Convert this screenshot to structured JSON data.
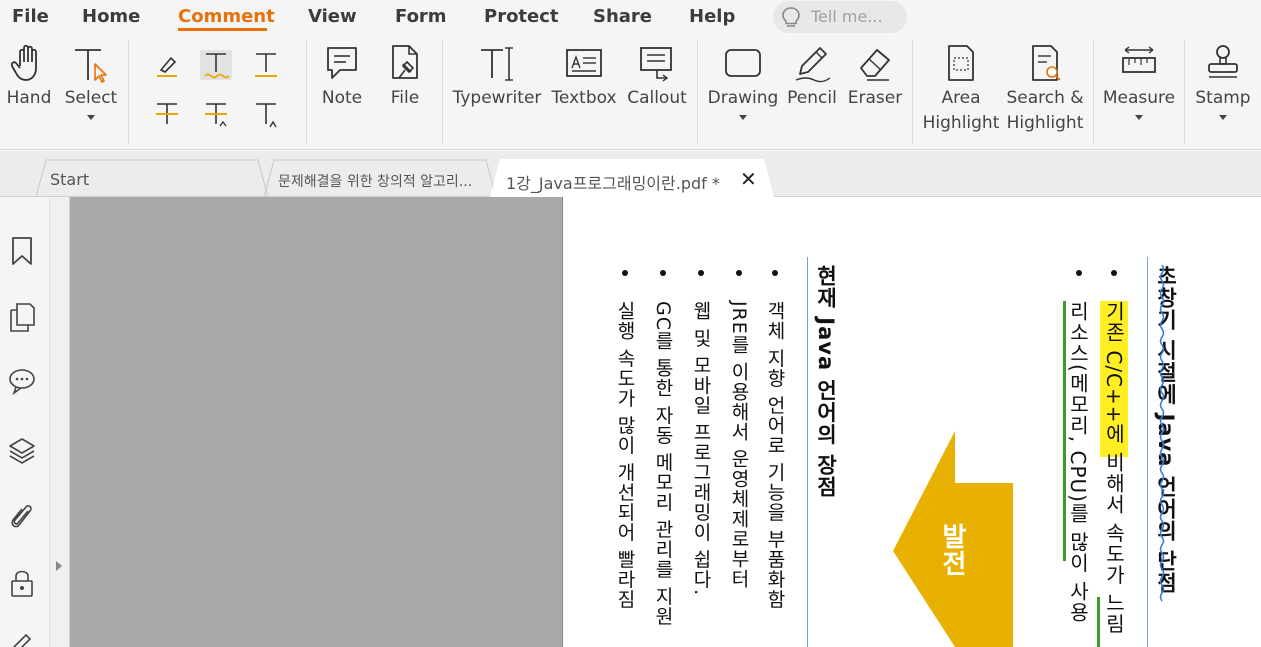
{
  "menu": {
    "items": [
      "File",
      "Home",
      "Comment",
      "View",
      "Form",
      "Protect",
      "Share",
      "Help"
    ],
    "active": "Comment",
    "tell_me_placeholder": "Tell me..."
  },
  "ribbon": {
    "hand": "Hand",
    "select": "Select",
    "note": "Note",
    "file": "File",
    "typewriter": "Typewriter",
    "textbox": "Textbox",
    "callout": "Callout",
    "drawing": "Drawing",
    "pencil": "Pencil",
    "eraser": "Eraser",
    "area_highlight_1": "Area",
    "area_highlight_2": "Highlight",
    "search_highlight_1": "Search &",
    "search_highlight_2": "Highlight",
    "measure": "Measure",
    "stamp": "Stamp"
  },
  "tabs": [
    {
      "label": "Start"
    },
    {
      "label": "문제해결을 위한 창의적 알고리..."
    },
    {
      "label": "1강_Java프로그래밍이란.pdf *"
    }
  ],
  "document": {
    "col1_title": "초창기 시절에 Java 언어의 단점",
    "col1_b1": "기존 C/C++에 비해서 속도가 느림",
    "col1_b2": "리소스(메모리, CPU)를 많이 사용",
    "arrow_label": "발전",
    "col2_title": "현재 Java 언어의 장점",
    "col2_b1": "객체 지향 언어로 기능을 부품화함",
    "col2_b2": "JRE를 이용해서 운영체제로부터",
    "col2_b3": "웹 및 모바일 프로그래밍이 쉽다.",
    "col2_b4": "GC를 통한 자동 메모리 관리를 지원",
    "col2_b5": "실행 속도가 많이 개선되어 빨라짐"
  },
  "colors": {
    "accent": "#e8710a",
    "arrow": "#e8b000",
    "highlight": "#ffee22",
    "underline": "#3c9a2c"
  }
}
